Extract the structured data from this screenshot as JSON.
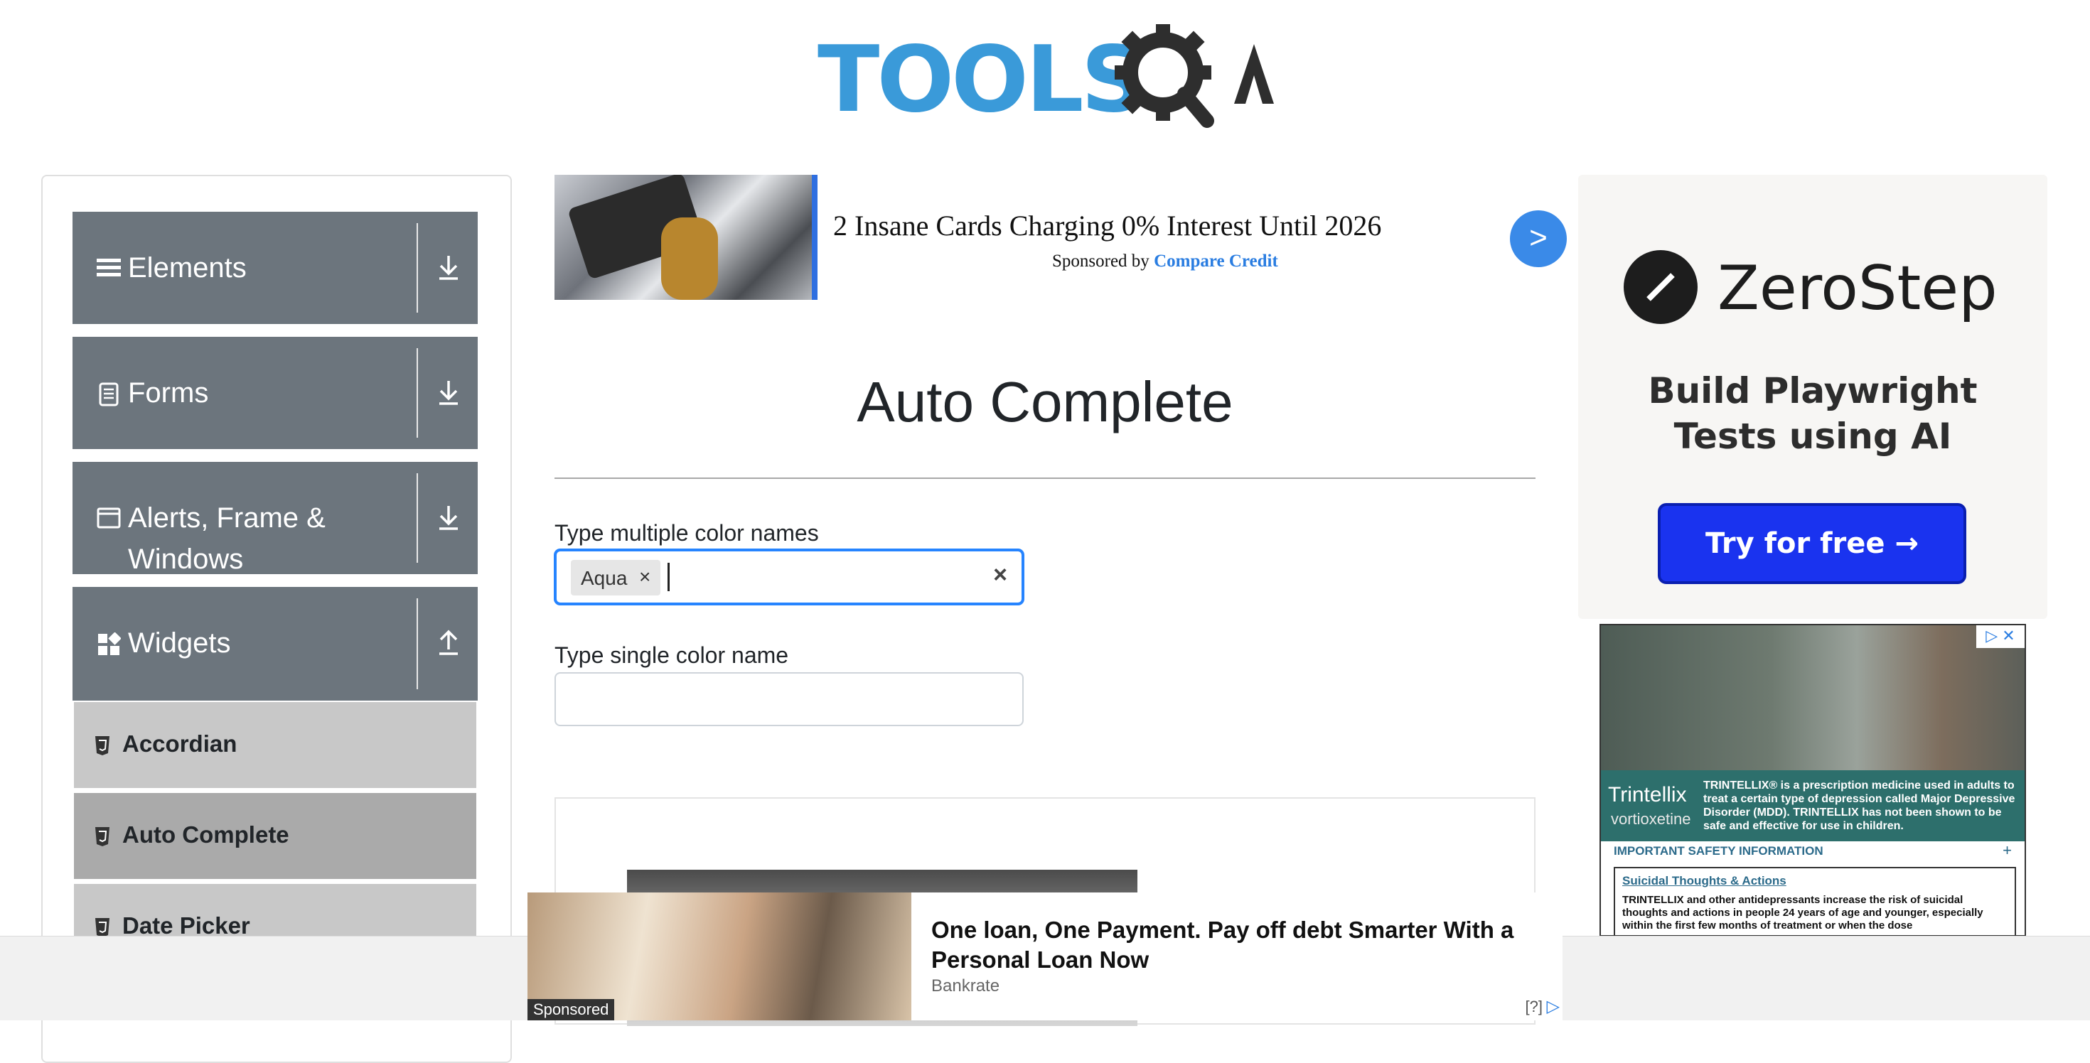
{
  "header": {
    "logo_part1": "TOOLS",
    "logo_part2": "QA"
  },
  "sidebar": {
    "groups": [
      {
        "label": "Elements",
        "icon": "hamburger-icon",
        "state": "collapsed"
      },
      {
        "label": "Forms",
        "icon": "document-icon",
        "state": "collapsed"
      },
      {
        "label": "Alerts, Frame & Windows",
        "icon": "window-icon",
        "state": "collapsed"
      },
      {
        "label": "Widgets",
        "icon": "widgets-icon",
        "state": "expanded"
      }
    ],
    "items": [
      {
        "label": "Accordian",
        "active": false
      },
      {
        "label": "Auto Complete",
        "active": true
      },
      {
        "label": "Date Picker",
        "active": false
      }
    ]
  },
  "top_ad": {
    "title": "2 Insane Cards Charging 0% Interest Until 2026",
    "sponsor_prefix": "Sponsored by ",
    "sponsor_name": "Compare Credit",
    "next_label": ">"
  },
  "main": {
    "title": "Auto Complete",
    "multi_label": "Type multiple color names",
    "multi_chip": "Aqua",
    "chip_remove": "×",
    "clear_symbol": "×",
    "single_label": "Type single color name",
    "single_value": ""
  },
  "right_ad": {
    "brand": "ZeroStep",
    "tagline_line1": "Build Playwright",
    "tagline_line2": "Tests using AI",
    "button": "Try for free →"
  },
  "right_ad2": {
    "brand": "Trintellix",
    "brand_sub": "vortioxetine",
    "description": "TRINTELLIX® is a prescription medicine used in adults to treat a certain type of depression called Major Depressive Disorder (MDD). TRINTELLIX has not been shown to be safe and effective for use in children.",
    "isi": "IMPORTANT SAFETY INFORMATION",
    "plus": "+",
    "box_heading": "Suicidal Thoughts & Actions",
    "box_text": "TRINTELLIX and other antidepressants increase the risk of suicidal thoughts and actions in people 24 years of age and younger, especially within the first few months of treatment or when the dose"
  },
  "bottom_ad": {
    "sponsored": "Sponsored",
    "title": "One loan, One Payment. Pay off debt Smarter With a Personal Loan Now",
    "source": "Bankrate",
    "help": "[?]",
    "adchoices": "▷"
  },
  "colors": {
    "sidebar_group": "#6c757d",
    "sidebar_item": "#c8c8c8",
    "sidebar_item_active": "#aaaaaa",
    "input_focus": "#2684ff",
    "logo_blue": "#3a9ad9",
    "zerostep_button": "#1a33ef"
  }
}
